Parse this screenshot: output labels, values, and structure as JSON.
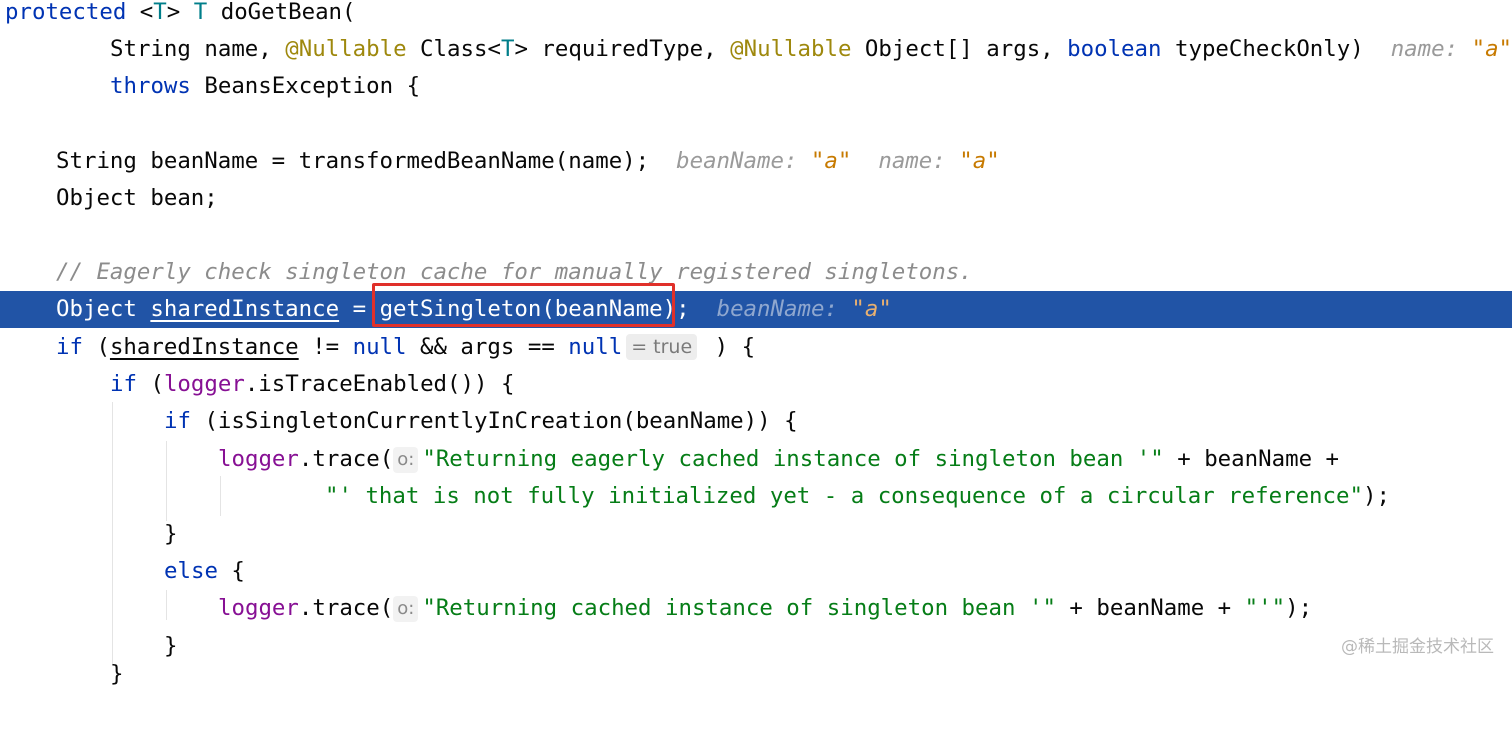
{
  "code": {
    "l1": {
      "protected": "protected",
      "lt": " <",
      "T1": "T",
      "gt": "> ",
      "T2": "T",
      "rest": " doGetBean("
    },
    "l2": {
      "a": "String name, ",
      "ann1": "@Nullable",
      "b": " Class<",
      "T": "T",
      "c": "> requiredType, ",
      "ann2": "@Nullable",
      "d": " Object[] args, ",
      "bool": "boolean",
      "e": " typeCheckOnly)",
      "hint_label": "name: ",
      "hint_val": "\"a\""
    },
    "l3": {
      "throws": "throws",
      "rest": " BeansException {"
    },
    "l4": {
      "code": "String beanName = transformedBeanName(name);",
      "hint1_label": "beanName: ",
      "hint1_val": "\"a\"",
      "hint2_label": "name: ",
      "hint2_val": "\"a\""
    },
    "l5": {
      "code": "Object bean;"
    },
    "l6": {
      "comment": "// Eagerly check singleton cache for manually registered singletons."
    },
    "l7": {
      "a": "Object ",
      "shared": "sharedInstance",
      "b": " = ",
      "call": "getSingleton(beanName)",
      "c": ";",
      "hint_label": "beanName: ",
      "hint_val": "\"a\""
    },
    "l8": {
      "if": "if",
      "a": " (",
      "shared": "sharedInstance",
      "b": " != ",
      "null1": "null",
      "c": " && args == ",
      "null2": "null",
      "inlay": "= true",
      "d": " ) {"
    },
    "l9": {
      "if": "if",
      "a": " (",
      "logger": "logger",
      "b": ".isTraceEnabled()) {"
    },
    "l10": {
      "if": "if",
      "a": " (isSingletonCurrentlyInCreation(beanName)) {"
    },
    "l11": {
      "logger": "logger",
      "a": ".trace(",
      "param": "o:",
      "str": "\"Returning eagerly cached instance of singleton bean '\"",
      "b": " + beanName +"
    },
    "l12": {
      "str": "\"' that is not fully initialized yet - a consequence of a circular reference\"",
      "b": ");"
    },
    "l13": {
      "brace": "}"
    },
    "l14": {
      "else": "else",
      "a": " {"
    },
    "l15": {
      "logger": "logger",
      "a": ".trace(",
      "param": "o:",
      "str": "\"Returning cached instance of singleton bean '\"",
      "b": " + beanName + ",
      "str2": "\"'\"",
      "c": ");"
    },
    "l16": {
      "brace": "}"
    },
    "l17": {
      "brace": "}"
    }
  },
  "watermark": "@稀土掘金技术社区",
  "colors": {
    "keyword": "#0033b3",
    "string": "#067d17",
    "annotation": "#9e880d",
    "field": "#871094",
    "selection": "#2154a6",
    "highlight_box": "#e0302a"
  }
}
